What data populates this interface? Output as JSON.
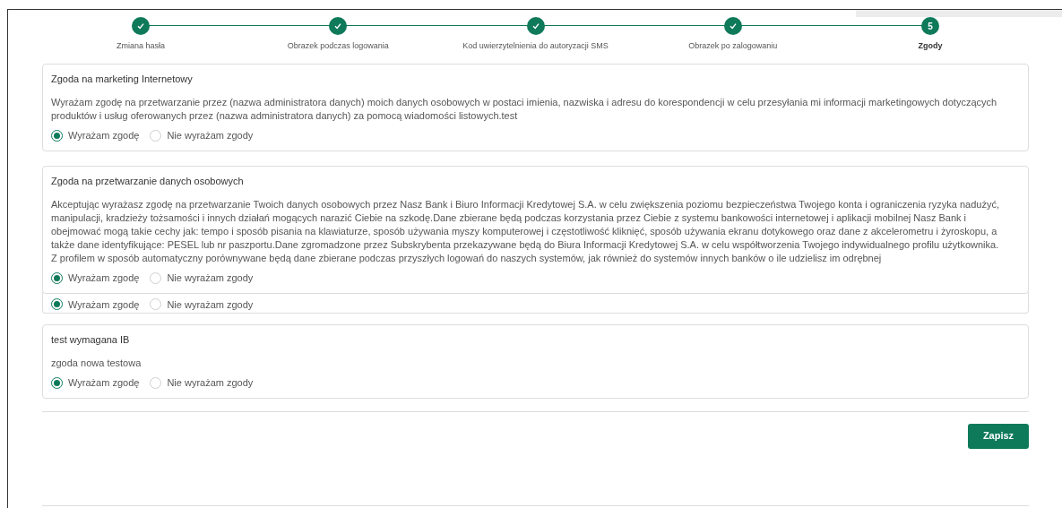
{
  "steps": [
    {
      "label": "Zmiana hasła",
      "completed": true,
      "selected": false
    },
    {
      "label": "Obrazek podczas logowania",
      "completed": true,
      "selected": false
    },
    {
      "label": "Kod uwierzytelnienia do autoryzacji SMS",
      "completed": true,
      "selected": false
    },
    {
      "label": "Obrazek po zalogowaniu",
      "completed": true,
      "selected": false
    },
    {
      "label": "Zgody",
      "number": "5",
      "completed": false,
      "selected": true
    }
  ],
  "consents": [
    {
      "kind": "card",
      "title": "Zgoda na marketing Internetowy",
      "text": "Wyrażam zgodę na przetwarzanie przez (nazwa administratora danych) moich danych osobowych w postaci imienia, nazwiska i adresu do korespondencji w celu przesyłania mi informacji marketingowych dotyczących produktów i usług oferowanych przez (nazwa administratora danych) za pomocą wiadomości listowych.test",
      "options": [
        {
          "label": "Wyrażam zgodę",
          "selected": true
        },
        {
          "label": "Nie wyrażam zgody",
          "selected": false
        }
      ]
    },
    {
      "kind": "card",
      "title": "Zgoda na przetwarzanie danych osobowych",
      "text": "Akceptując wyrażasz zgodę na przetwarzanie Twoich danych osobowych przez Nasz Bank i Biuro Informacji Kredytowej S.A. w celu zwiększenia poziomu bezpieczeństwa Twojego konta i ograniczenia ryzyka nadużyć, manipulacji, kradzieży tożsamości i innych działań mogących narazić Ciebie na szkodę.Dane zbierane będą podczas korzystania przez Ciebie z systemu bankowości internetowej i aplikacji mobilnej Nasz Bank i obejmować mogą takie cechy jak: tempo i sposób pisania na klawiaturze, sposób używania myszy komputerowej i częstotliwość kliknięć, sposób używania ekranu dotykowego oraz dane z akcelerometru i żyroskopu, a także dane identyfikujące: PESEL lub nr paszportu.Dane zgromadzone przez Subskrybenta przekazywane będą do Biura Informacji Kredytowej S.A. w celu współtworzenia Twojego indywidualnego profilu użytkownika. Z profilem w sposób automatyczny porównywane będą dane zbierane podczas przyszłych logowań do naszych systemów, jak również do systemów innych banków o ile udzielisz im odrębnej",
      "options": [
        {
          "label": "Wyrażam zgodę",
          "selected": true
        },
        {
          "label": "Nie wyrażam zgody",
          "selected": false
        }
      ]
    },
    {
      "kind": "covered",
      "options": [
        {
          "label": "Wyrażam zgodę",
          "selected": true
        },
        {
          "label": "Nie wyrażam zgody",
          "selected": false
        }
      ]
    },
    {
      "kind": "card",
      "title": "test wymagana IB",
      "text": "zgoda nowa testowa",
      "options": [
        {
          "label": "Wyrażam zgodę",
          "selected": true
        },
        {
          "label": "Nie wyrażam zgody",
          "selected": false
        }
      ]
    }
  ],
  "save_button": "Zapisz"
}
